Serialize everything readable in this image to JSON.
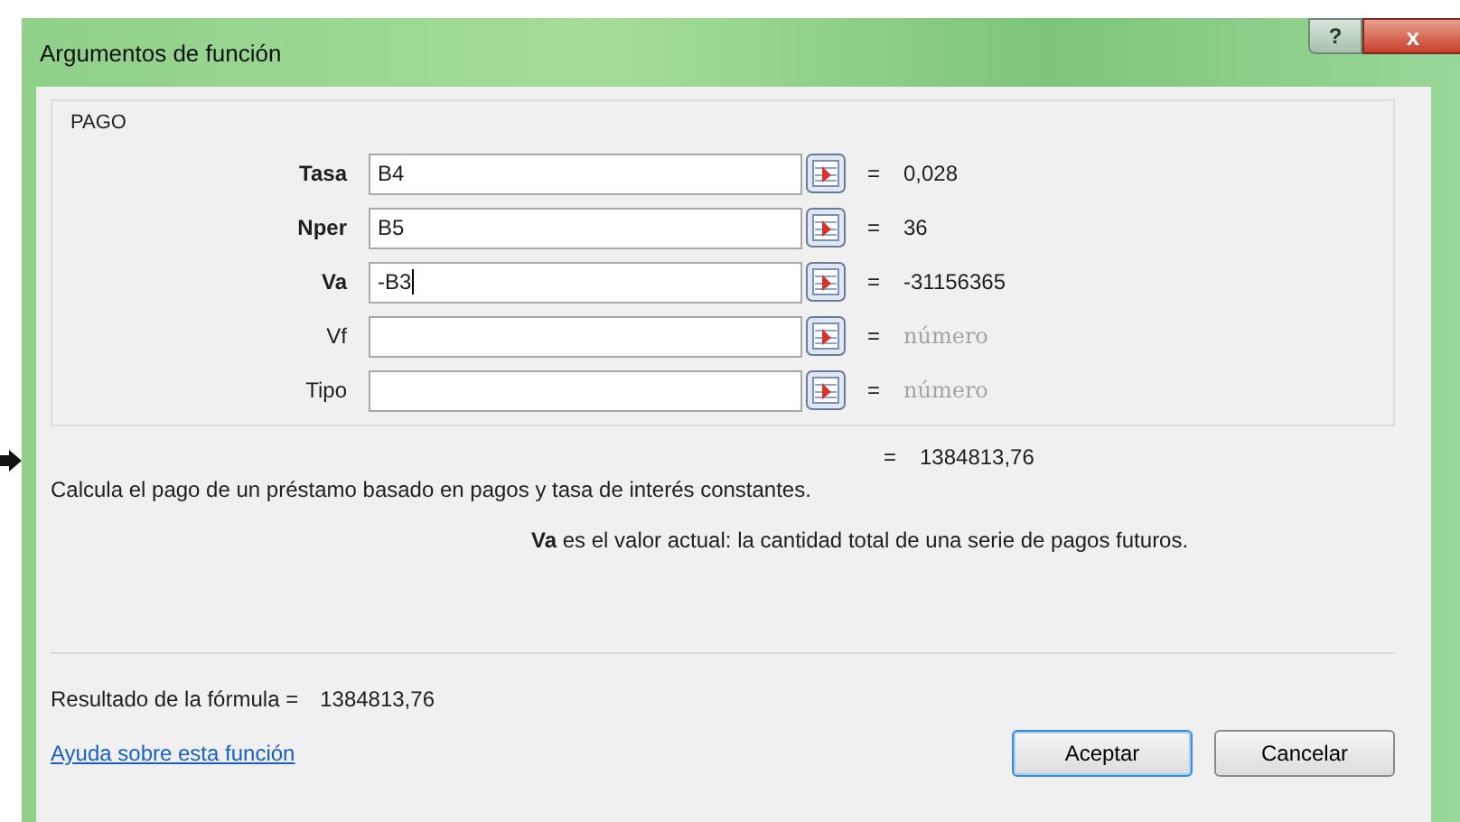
{
  "window": {
    "title": "Argumentos de función",
    "help_button": "?",
    "close_button": "x"
  },
  "function_name": "PAGO",
  "arguments": [
    {
      "label": "Tasa",
      "required": true,
      "value": "B4",
      "focused": false,
      "result": "0,028",
      "result_muted": false
    },
    {
      "label": "Nper",
      "required": true,
      "value": "B5",
      "focused": false,
      "result": "36",
      "result_muted": false
    },
    {
      "label": "Va",
      "required": true,
      "value": "-B3",
      "focused": true,
      "result": "-31156365",
      "result_muted": false
    },
    {
      "label": "Vf",
      "required": false,
      "focused": false,
      "result": "número",
      "result_muted": true
    },
    {
      "label": "Tipo",
      "required": false,
      "focused": false,
      "result": "número",
      "result_muted": true
    }
  ],
  "equals_sign": "=",
  "function_result": "1384813,76",
  "description": "Calcula el pago de un préstamo basado en pagos y tasa de interés constantes.",
  "argument_help": "**Va**   es el valor actual: la cantidad total de una serie de pagos futuros.",
  "formula_result_label": "Resultado de la fórmula =",
  "formula_result": "1384813,76",
  "help_link": "Ayuda sobre esta función",
  "buttons": [
    {
      "label": "Aceptar",
      "default": true
    },
    {
      "label": "Cancelar",
      "default": false
    }
  ]
}
